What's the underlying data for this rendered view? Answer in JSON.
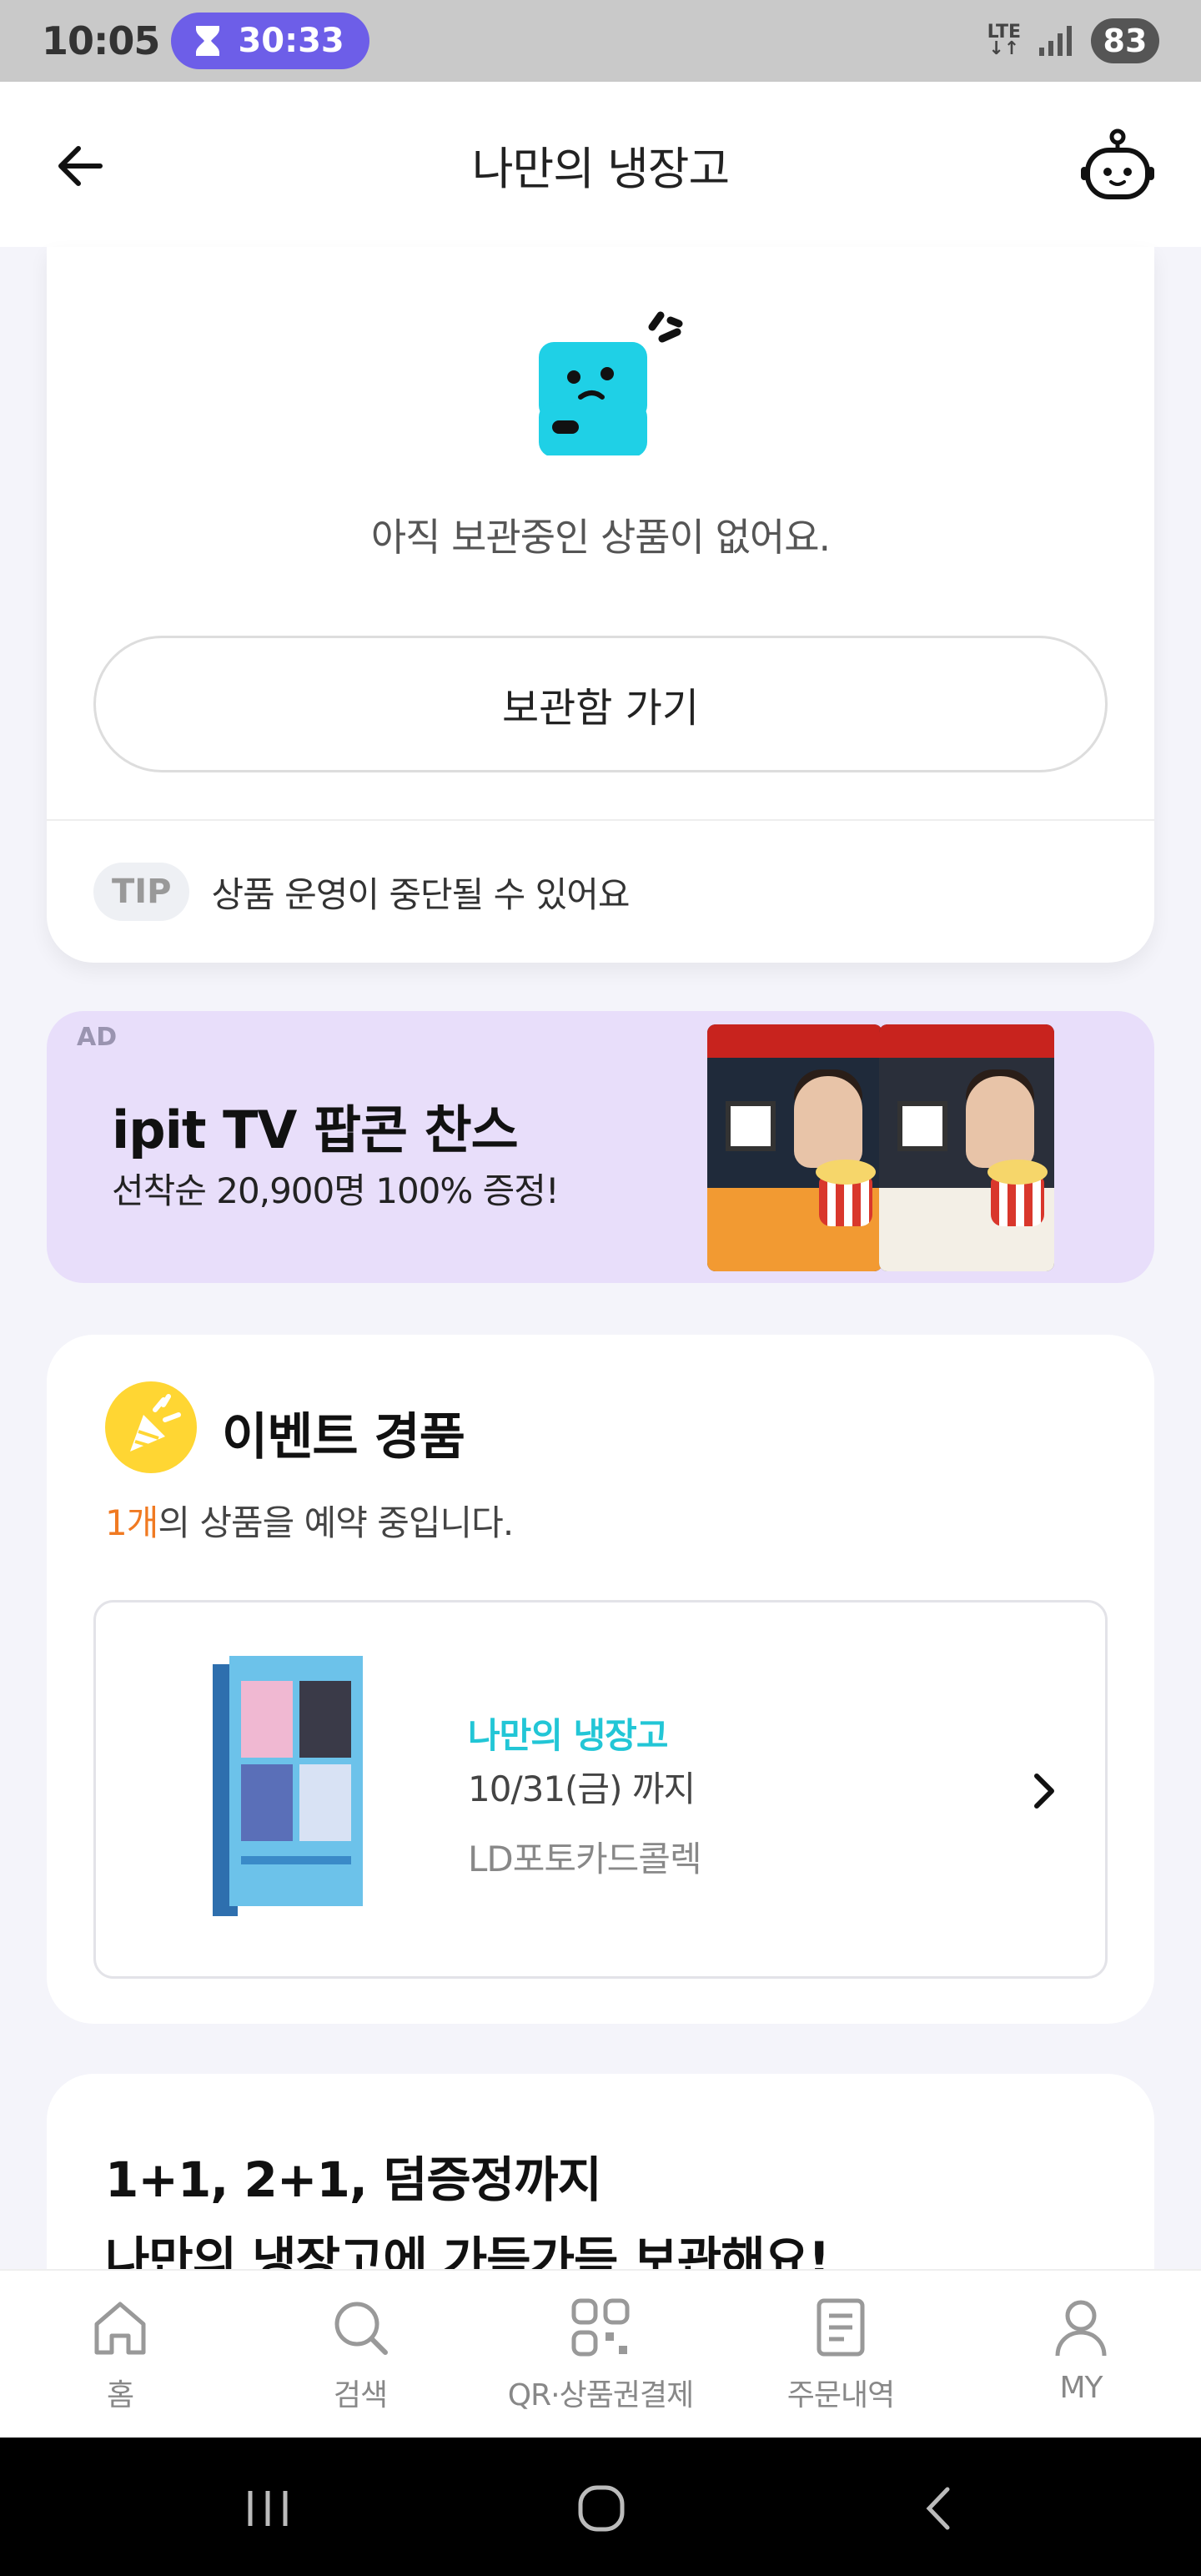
{
  "status_bar": {
    "time": "10:05",
    "timer": "30:33",
    "network": "LTE",
    "battery": "83"
  },
  "header": {
    "title": "나만의 냉장고",
    "back_icon": "arrow-left-icon",
    "bot_icon": "chatbot-icon"
  },
  "storage": {
    "empty_message": "아직 보관중인 상품이 없어요.",
    "go_button_label": "보관함 가기",
    "tip_badge": "TIP",
    "tip_text": "상품 운영이 중단될 수 있어요"
  },
  "ad": {
    "label": "AD",
    "title": "ipit TV 팝콘 찬스",
    "subtitle": "선착순 20,900명 100% 증정!"
  },
  "event": {
    "title": "이벤트 경품",
    "count": "1개",
    "count_suffix": "의 상품을 예약 중입니다.",
    "item": {
      "name": "나만의 냉장고",
      "date": "10/31(금) 까지",
      "product": "LD포토카드콜렉"
    }
  },
  "promo": {
    "line1": "1+1, 2+1, 덤증정까지",
    "line2": "나만의 냉장고에 가득가득 보관해요!"
  },
  "bottom_nav": {
    "items": [
      {
        "label": "홈",
        "icon": "home-icon"
      },
      {
        "label": "검색",
        "icon": "search-icon"
      },
      {
        "label": "QR·상품권결제",
        "icon": "qr-icon"
      },
      {
        "label": "주문내역",
        "icon": "receipt-icon"
      },
      {
        "label": "MY",
        "icon": "person-icon"
      }
    ]
  },
  "colors": {
    "accent": "#22c6d6",
    "count": "#f07a22",
    "timer_pill": "#6d5ee8",
    "ad_bg": "#e8defa",
    "event_icon": "#ffd633"
  }
}
